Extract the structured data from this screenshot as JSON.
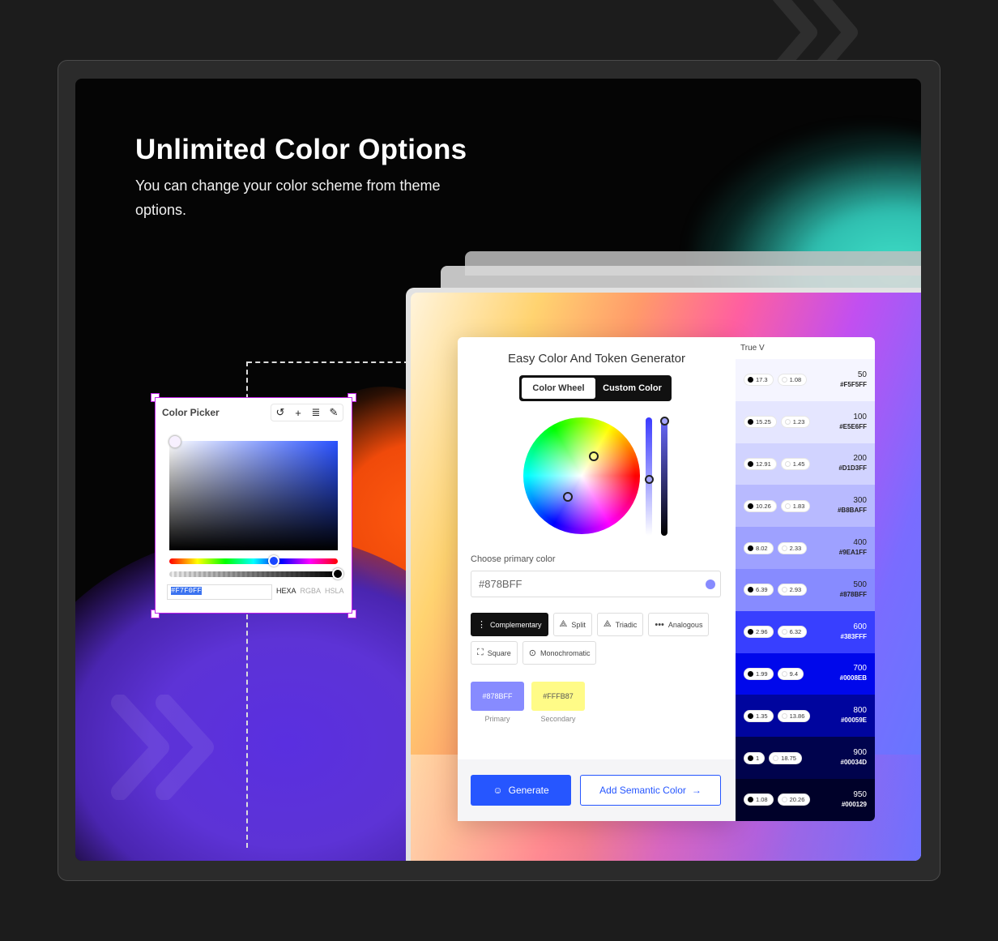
{
  "hero": {
    "title": "Unlimited Color Options",
    "subtitle": "You can change your color scheme from theme options."
  },
  "picker": {
    "title": "Color Picker",
    "tools": [
      {
        "name": "reset-icon",
        "glyph": "↺"
      },
      {
        "name": "plus-icon",
        "glyph": "+"
      },
      {
        "name": "database-icon",
        "glyph": "≣"
      },
      {
        "name": "eyedropper-icon",
        "glyph": "✎"
      }
    ],
    "hex_value": "#F7F0FF",
    "modes": [
      "HEXA",
      "RGBA",
      "HSLA"
    ],
    "active_mode": "HEXA"
  },
  "generator": {
    "title": "Easy Color And Token Generator",
    "tabs": [
      "Color Wheel",
      "Custom Color"
    ],
    "active_tab": "Custom Color",
    "primary_label": "Choose primary color",
    "primary_value": "#878BFF",
    "harmonies": [
      {
        "label": "Complementary",
        "icon": "complementary-icon",
        "glyph": "⋮",
        "selected": true
      },
      {
        "label": "Split",
        "icon": "split-icon",
        "glyph": "⟁",
        "selected": false
      },
      {
        "label": "Triadic",
        "icon": "triadic-icon",
        "glyph": "⟁",
        "selected": false
      },
      {
        "label": "Analogous",
        "icon": "analogous-icon",
        "glyph": "•••",
        "selected": false
      },
      {
        "label": "Square",
        "icon": "square-icon",
        "glyph": "⛶",
        "selected": false
      },
      {
        "label": "Monochromatic",
        "icon": "monochromatic-icon",
        "glyph": "⊙",
        "selected": false
      }
    ],
    "swatches": [
      {
        "hex": "#878BFF",
        "label": "Primary",
        "bg": "#878bff",
        "fg": "#ffffff"
      },
      {
        "hex": "#FFFB87",
        "label": "Secondary",
        "bg": "#fffb87",
        "fg": "#555555"
      }
    ],
    "generate_label": "Generate",
    "semantic_label": "Add Semantic Color"
  },
  "scale": {
    "title": "True V",
    "rows": [
      {
        "step": "50",
        "hex": "#F5F5FF",
        "dark": "17.3",
        "light": "1.08",
        "bg": "#f5f5ff",
        "fg": "#222222"
      },
      {
        "step": "100",
        "hex": "#E5E6FF",
        "dark": "15.25",
        "light": "1.23",
        "bg": "#e5e6ff",
        "fg": "#222222"
      },
      {
        "step": "200",
        "hex": "#D1D3FF",
        "dark": "12.91",
        "light": "1.45",
        "bg": "#d1d3ff",
        "fg": "#222222"
      },
      {
        "step": "300",
        "hex": "#B8BAFF",
        "dark": "10.26",
        "light": "1.83",
        "bg": "#b8baff",
        "fg": "#222222"
      },
      {
        "step": "400",
        "hex": "#9EA1FF",
        "dark": "8.02",
        "light": "2.33",
        "bg": "#9ea1ff",
        "fg": "#222222"
      },
      {
        "step": "500",
        "hex": "#878BFF",
        "dark": "6.39",
        "light": "2.93",
        "bg": "#878bff",
        "fg": "#222222"
      },
      {
        "step": "600",
        "hex": "#383FFF",
        "dark": "2.96",
        "light": "6.32",
        "bg": "#383fff",
        "fg": "#ffffff"
      },
      {
        "step": "700",
        "hex": "#0008EB",
        "dark": "1.99",
        "light": "9.4",
        "bg": "#0008eb",
        "fg": "#ffffff"
      },
      {
        "step": "800",
        "hex": "#00059E",
        "dark": "1.35",
        "light": "13.86",
        "bg": "#00059e",
        "fg": "#ffffff"
      },
      {
        "step": "900",
        "hex": "#00034D",
        "dark": "1",
        "light": "18.75",
        "bg": "#00034d",
        "fg": "#ffffff"
      },
      {
        "step": "950",
        "hex": "#000129",
        "dark": "1.08",
        "light": "20.26",
        "bg": "#000129",
        "fg": "#ffffff"
      }
    ]
  }
}
